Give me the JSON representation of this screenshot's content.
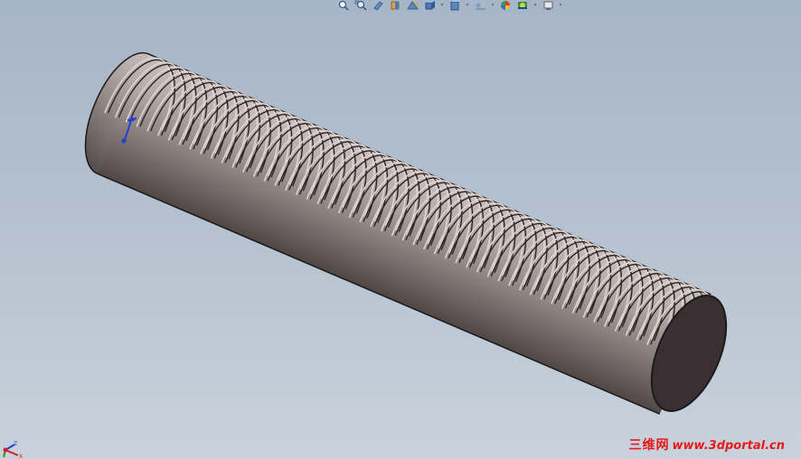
{
  "toolbar": {
    "items": [
      {
        "icon": "zoom-to-fit-icon",
        "has_dropdown": false
      },
      {
        "icon": "zoom-to-area-icon",
        "has_dropdown": false
      },
      {
        "icon": "previous-view-icon",
        "has_dropdown": false
      },
      {
        "icon": "section-view-icon",
        "has_dropdown": false
      },
      {
        "icon": "dynamic-annotation-views-icon",
        "has_dropdown": false
      },
      {
        "icon": "view-orientation-icon",
        "has_dropdown": true
      },
      {
        "icon": "display-style-icon",
        "has_dropdown": true
      },
      {
        "icon": "hide-show-items-icon",
        "has_dropdown": true
      },
      {
        "icon": "edit-appearance-icon",
        "has_dropdown": false
      },
      {
        "icon": "apply-scene-icon",
        "has_dropdown": true
      },
      {
        "icon": "view-settings-icon",
        "has_dropdown": true
      }
    ],
    "dropdown_glyph": "▾"
  },
  "model": {
    "part": "threaded-rod",
    "thread_count": 52,
    "body_color": "#a89e9c",
    "end_face_color": "#3a3034",
    "edge_color": "#1a1a1a"
  },
  "triad": {
    "axes": [
      "X",
      "Y",
      "Z"
    ],
    "colors": {
      "x": "#d42020",
      "y": "#1f9a1f",
      "z": "#1f3fd4"
    }
  },
  "watermark": {
    "cn": "三维网",
    "url": "www.3dportal.cn",
    "color": "#e31b1b"
  }
}
